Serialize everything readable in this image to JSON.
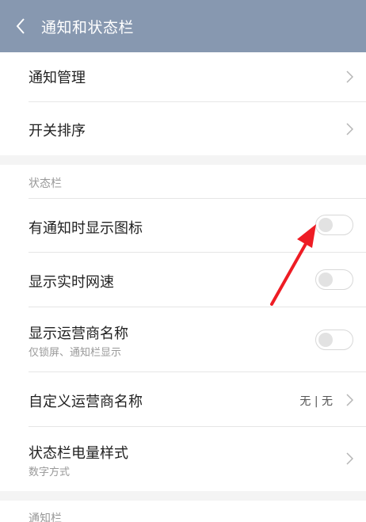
{
  "header": {
    "title": "通知和状态栏"
  },
  "items": {
    "notification_management": {
      "label": "通知管理"
    },
    "toggle_order": {
      "label": "开关排序"
    },
    "show_icon": {
      "label": "有通知时显示图标",
      "enabled": false
    },
    "realtime_speed": {
      "label": "显示实时网速",
      "enabled": false
    },
    "carrier_name": {
      "label": "显示运营商名称",
      "sub": "仅锁屏、通知栏显示",
      "enabled": false
    },
    "custom_carrier": {
      "label": "自定义运营商名称",
      "value": "无 | 无"
    },
    "battery_style": {
      "label": "状态栏电量样式",
      "sub": "数字方式"
    }
  },
  "sections": {
    "status_bar": "状态栏",
    "notification_bar": "通知栏"
  },
  "colors": {
    "header_bg": "#8798b0",
    "annotation_arrow": "#ee1c24"
  }
}
